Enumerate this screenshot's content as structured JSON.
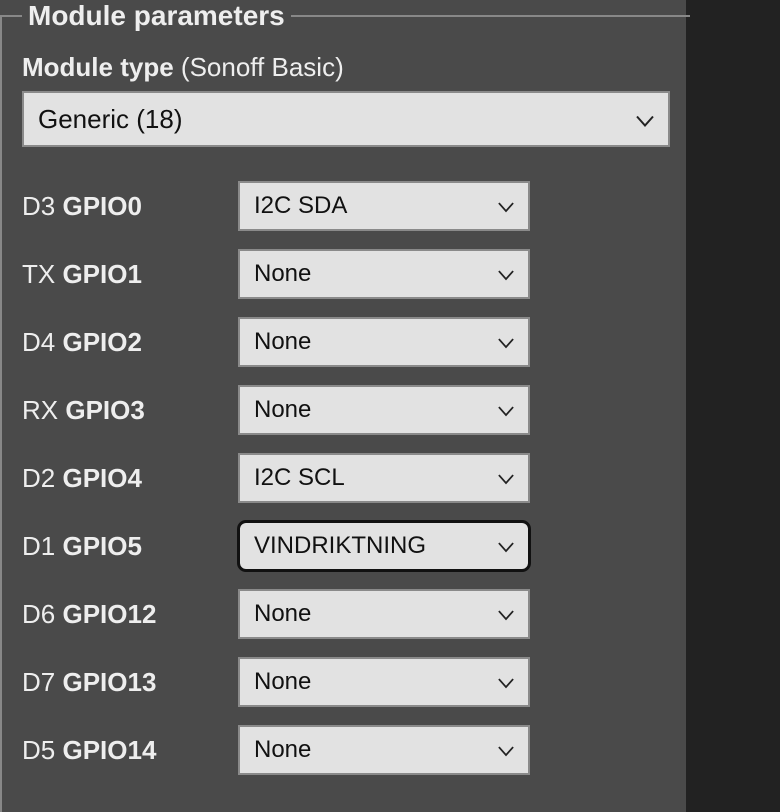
{
  "legend": "Module parameters",
  "module_type_label": "Module type",
  "module_type_current": "(Sonoff Basic)",
  "module_select_value": "Generic (18)",
  "gpio_rows": [
    {
      "prefix": "D3 ",
      "name": "GPIO0",
      "value": "I2C SDA",
      "focused": false
    },
    {
      "prefix": "TX ",
      "name": "GPIO1",
      "value": "None",
      "focused": false
    },
    {
      "prefix": "D4 ",
      "name": "GPIO2",
      "value": "None",
      "focused": false
    },
    {
      "prefix": "RX ",
      "name": "GPIO3",
      "value": "None",
      "focused": false
    },
    {
      "prefix": "D2 ",
      "name": "GPIO4",
      "value": "I2C SCL",
      "focused": false
    },
    {
      "prefix": "D1 ",
      "name": "GPIO5",
      "value": "VINDRIKTNING",
      "focused": true
    },
    {
      "prefix": "D6 ",
      "name": "GPIO12",
      "value": "None",
      "focused": false
    },
    {
      "prefix": "D7 ",
      "name": "GPIO13",
      "value": "None",
      "focused": false
    },
    {
      "prefix": "D5 ",
      "name": "GPIO14",
      "value": "None",
      "focused": false
    }
  ]
}
